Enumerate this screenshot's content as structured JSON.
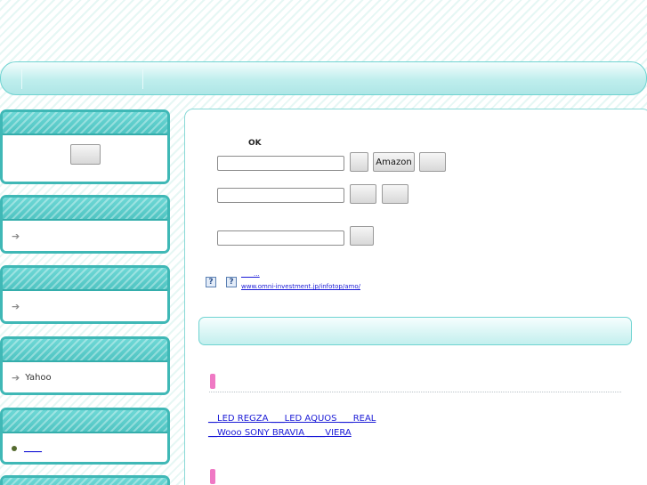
{
  "nav": {
    "items": [
      "",
      ""
    ]
  },
  "sidebar": {
    "boxes": [
      {
        "title": "",
        "button_label": ""
      },
      {
        "title": "",
        "item": ""
      },
      {
        "title": "",
        "item": ""
      },
      {
        "title": "",
        "item": "Yahoo"
      },
      {
        "title": "",
        "item": "____"
      }
    ]
  },
  "search": {
    "ok_label": "OK",
    "row1": {
      "value": "",
      "btn1": "",
      "btn_amazon": "Amazon",
      "btn3": ""
    },
    "row2": {
      "value": "",
      "btn1": "",
      "btn2": ""
    },
    "row3": {
      "value": "",
      "btn1": ""
    }
  },
  "links": {
    "short_link": "____...",
    "url": "www.omni-investment.jp/infotop/amo/"
  },
  "section": {
    "title": ""
  },
  "tv_links": {
    "row1": [
      "__LED REGZA",
      " ___LED AQUOS",
      " ___REAL"
    ],
    "row2": [
      "__Wooo",
      " SONY BRAVIA",
      " ____VIERA"
    ]
  },
  "colors": {
    "accent": "#3fb8b6",
    "link": "#1a1ad6",
    "pink": "#ef79c4"
  }
}
